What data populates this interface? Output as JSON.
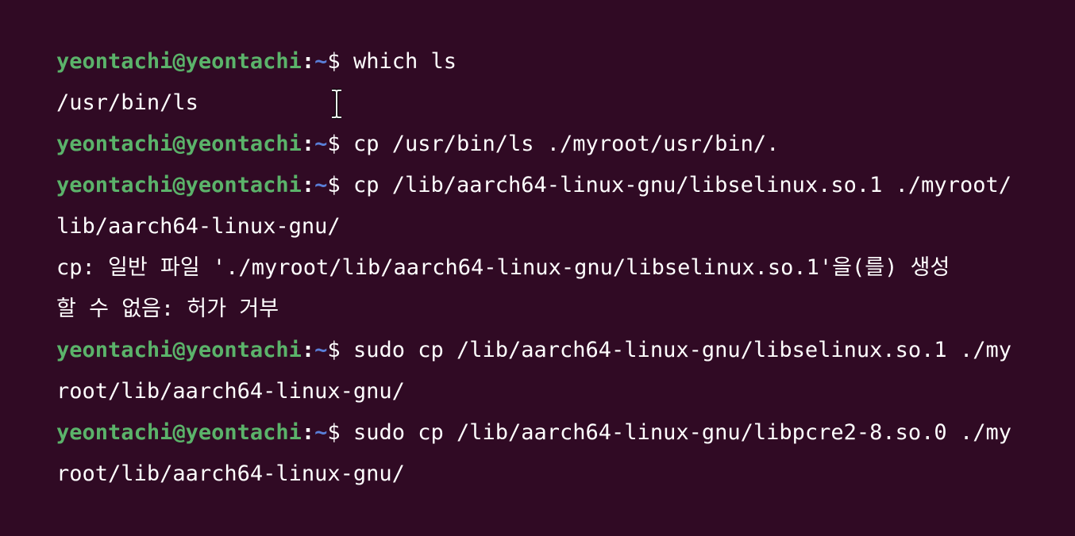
{
  "colors": {
    "background": "#300a24",
    "user_host": "#5bb36a",
    "cwd": "#5a7fd8",
    "text": "#ffffff"
  },
  "prompt": {
    "user_host": "yeontachi@yeontachi",
    "colon": ":",
    "cwd": "~",
    "symbol": "$"
  },
  "lines": [
    {
      "kind": "prompt",
      "command": " which ls"
    },
    {
      "kind": "output",
      "text": "/usr/bin/ls"
    },
    {
      "kind": "prompt",
      "command": " cp /usr/bin/ls ./myroot/usr/bin/."
    },
    {
      "kind": "prompt",
      "command": " cp /lib/aarch64-linux-gnu/libselinux.so.1 ./myroot/"
    },
    {
      "kind": "output",
      "text": "lib/aarch64-linux-gnu/"
    },
    {
      "kind": "output",
      "text": "cp: 일반 파일 './myroot/lib/aarch64-linux-gnu/libselinux.so.1'을(를) 생성"
    },
    {
      "kind": "output",
      "text": "할 수 없음: 허가 거부"
    },
    {
      "kind": "prompt",
      "command": " sudo cp /lib/aarch64-linux-gnu/libselinux.so.1 ./my"
    },
    {
      "kind": "output",
      "text": "root/lib/aarch64-linux-gnu/"
    },
    {
      "kind": "prompt",
      "command": " sudo cp /lib/aarch64-linux-gnu/libpcre2-8.so.0 ./my"
    },
    {
      "kind": "output",
      "text": "root/lib/aarch64-linux-gnu/"
    }
  ],
  "mouse_cursor": "ibeam-cursor-icon"
}
